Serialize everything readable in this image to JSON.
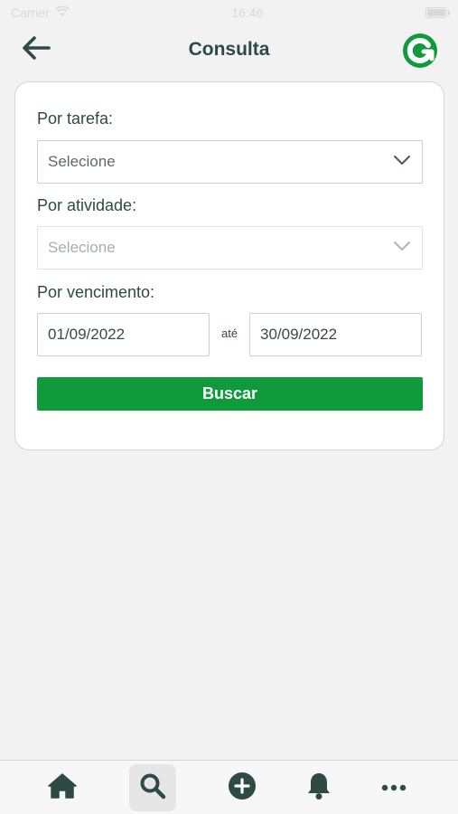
{
  "status_bar": {
    "carrier": "Carrier",
    "time": "16:46"
  },
  "nav": {
    "title": "Consulta",
    "back_icon": "arrow-left-icon",
    "logo_icon": "app-logo-icon"
  },
  "form": {
    "task_label": "Por tarefa:",
    "task_select_value": "Selecione",
    "activity_label": "Por atividade:",
    "activity_select_value": "Selecione",
    "due_label": "Por vencimento:",
    "date_from": "01/09/2022",
    "date_separator": "até",
    "date_to": "30/09/2022",
    "search_button": "Buscar"
  },
  "tab_bar": {
    "items": [
      {
        "icon": "home-icon",
        "active": false
      },
      {
        "icon": "search-icon",
        "active": true
      },
      {
        "icon": "add-circle-icon",
        "active": false
      },
      {
        "icon": "bell-icon",
        "active": false
      },
      {
        "icon": "more-icon",
        "active": false
      }
    ]
  },
  "colors": {
    "accent": "#0f9a3c",
    "text": "#2e4a44",
    "background": "#f2f2f2"
  }
}
